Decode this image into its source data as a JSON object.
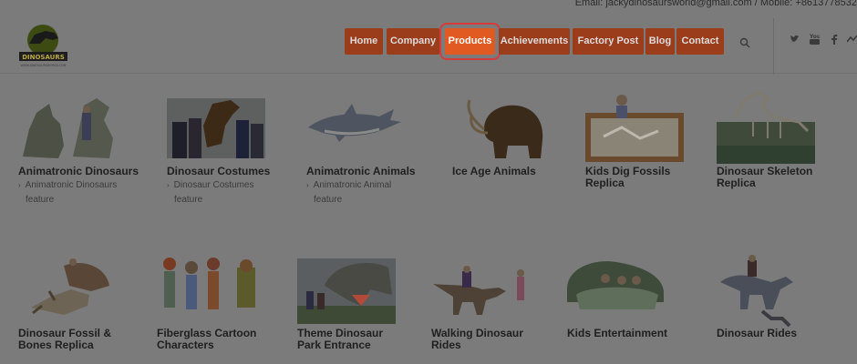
{
  "topbar": {
    "email_label": "Email:",
    "email": "jackydinosaursworld@gmail.com",
    "separator": "/",
    "mobile_label": "Mobile:",
    "mobile": "+8613778532"
  },
  "logo": {
    "text": "DINOSAURS",
    "subtext": "WWW.DINOSAURSWORLD.COM"
  },
  "nav": {
    "items": [
      {
        "label": "Home"
      },
      {
        "label": "Company"
      },
      {
        "label": "Products"
      },
      {
        "label": "Achievements"
      },
      {
        "label": "Factory Post"
      },
      {
        "label": "Blog"
      },
      {
        "label": "Contact"
      }
    ],
    "active": "Products"
  },
  "social": [
    "twitter-icon",
    "youtube-icon",
    "facebook-icon",
    "flickr-icon"
  ],
  "products": [
    {
      "title": "Animatronic Dinosaurs",
      "sub": "Animatronic Dinosaurs",
      "feature": "feature"
    },
    {
      "title": "Dinosaur Costumes",
      "sub": "Dinosaur Costumes",
      "feature": "feature"
    },
    {
      "title": "Animatronic Animals",
      "sub": "Animatronic Animal",
      "feature": "feature"
    },
    {
      "title": "Ice Age Animals"
    },
    {
      "title": "Kids Dig Fossils\nReplica"
    },
    {
      "title": "Dinosaur Skeleton\nReplica"
    },
    {
      "title": "Dinosaur Fossil &\nBones Replica"
    },
    {
      "title": "Fiberglass Cartoon\nCharacters"
    },
    {
      "title": "Theme Dinosaur\nPark Entrance"
    },
    {
      "title": "Walking Dinosaur\nRides"
    },
    {
      "title": "Kids Entertainment"
    },
    {
      "title": "Dinosaur Rides"
    }
  ],
  "colors": {
    "nav_bg": "#9b3c1b",
    "nav_active": "#e05a21",
    "highlight": "#d43c3c",
    "overlay": "#7b7b7b"
  }
}
